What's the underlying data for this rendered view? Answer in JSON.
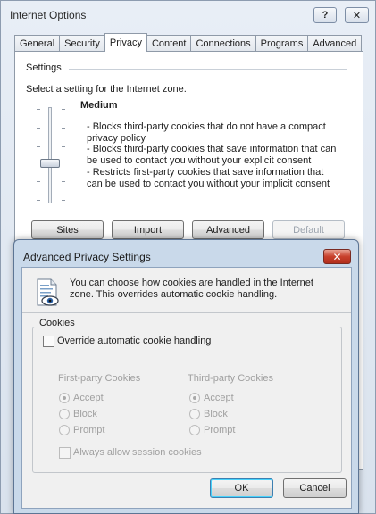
{
  "window": {
    "title": "Internet Options",
    "help_label": "?",
    "close_label": "✕"
  },
  "tabs": [
    {
      "label": "General"
    },
    {
      "label": "Security"
    },
    {
      "label": "Privacy"
    },
    {
      "label": "Content"
    },
    {
      "label": "Connections"
    },
    {
      "label": "Programs"
    },
    {
      "label": "Advanced"
    }
  ],
  "active_tab": "Privacy",
  "settings": {
    "group_label": "Settings",
    "zone_instruction": "Select a setting for the Internet zone.",
    "level_name": "Medium",
    "level_description": [
      "- Blocks third-party cookies that do not have a compact",
      "privacy policy",
      "- Blocks third-party cookies that save information that can",
      "be used to contact you without your explicit consent",
      "- Restricts first-party cookies that save information that",
      "can be used to contact you without your implicit consent"
    ]
  },
  "buttons": {
    "sites": "Sites",
    "import": "Import",
    "advanced": "Advanced",
    "default": "Default"
  },
  "advanced_dialog": {
    "title": "Advanced Privacy Settings",
    "close_label": "✕",
    "info_line1": "You can choose how cookies are handled in the Internet",
    "info_line2": "zone.  This overrides automatic cookie handling.",
    "cookies_group_label": "Cookies",
    "override_label": "Override automatic cookie handling",
    "override_checked": false,
    "first_party": {
      "heading": "First-party Cookies",
      "options": [
        "Accept",
        "Block",
        "Prompt"
      ],
      "selected": "Accept"
    },
    "third_party": {
      "heading": "Third-party Cookies",
      "options": [
        "Accept",
        "Block",
        "Prompt"
      ],
      "selected": "Accept"
    },
    "session_label": "Always allow session cookies",
    "session_checked": false,
    "ok_label": "OK",
    "cancel_label": "Cancel"
  }
}
